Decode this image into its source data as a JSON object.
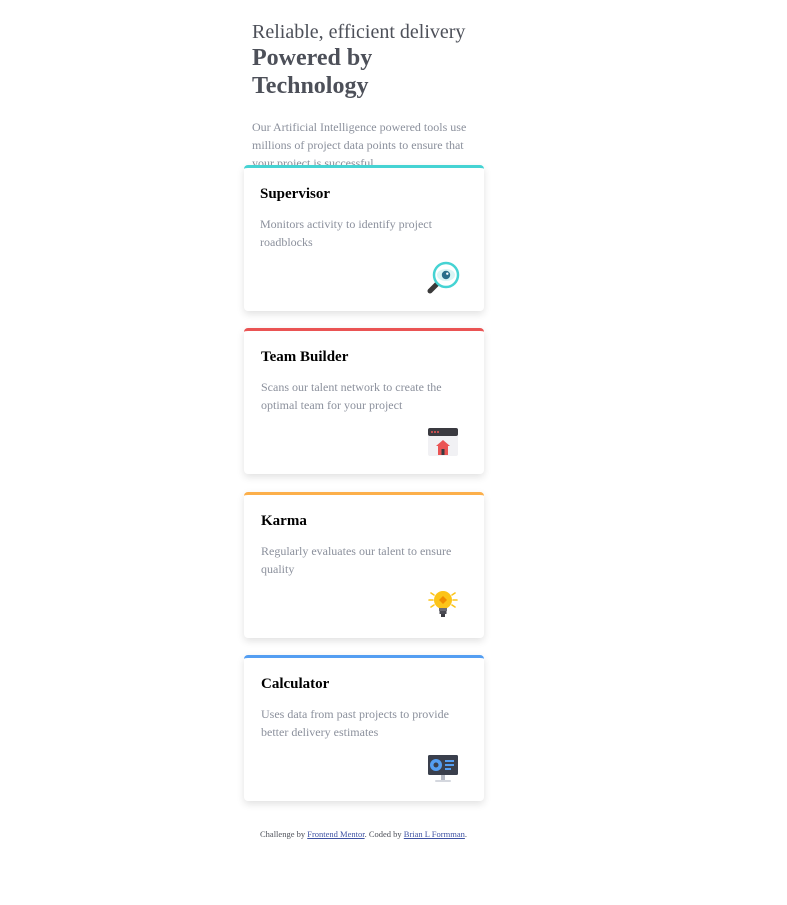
{
  "header": {
    "kicker": "Reliable, efficient delivery",
    "headline": "Powered by Technology",
    "lead": "Our Artificial Intelligence powered tools use millions of project data points to ensure that your project is successful"
  },
  "cards": [
    {
      "title": "Supervisor",
      "description": "Monitors activity to identify project roadblocks",
      "accent": "#45d3d3",
      "icon": "magnifying-glass-eye-icon"
    },
    {
      "title": "Team Builder",
      "description": "Scans our talent network to create the optimal team for your project",
      "accent": "#ea5454",
      "icon": "browser-house-icon"
    },
    {
      "title": "Karma",
      "description": "Regularly evaluates our talent to ensure quality",
      "accent": "#fcaf4a",
      "icon": "lightbulb-icon"
    },
    {
      "title": "Calculator",
      "description": "Uses data from past projects to provide better delivery estimates",
      "accent": "#549ef2",
      "icon": "monitor-chart-icon"
    }
  ],
  "attribution": {
    "prefix": "Challenge by ",
    "link1": "Frontend Mentor",
    "middle": ". Coded by ",
    "link2": "Brian L Formman",
    "suffix": "."
  }
}
